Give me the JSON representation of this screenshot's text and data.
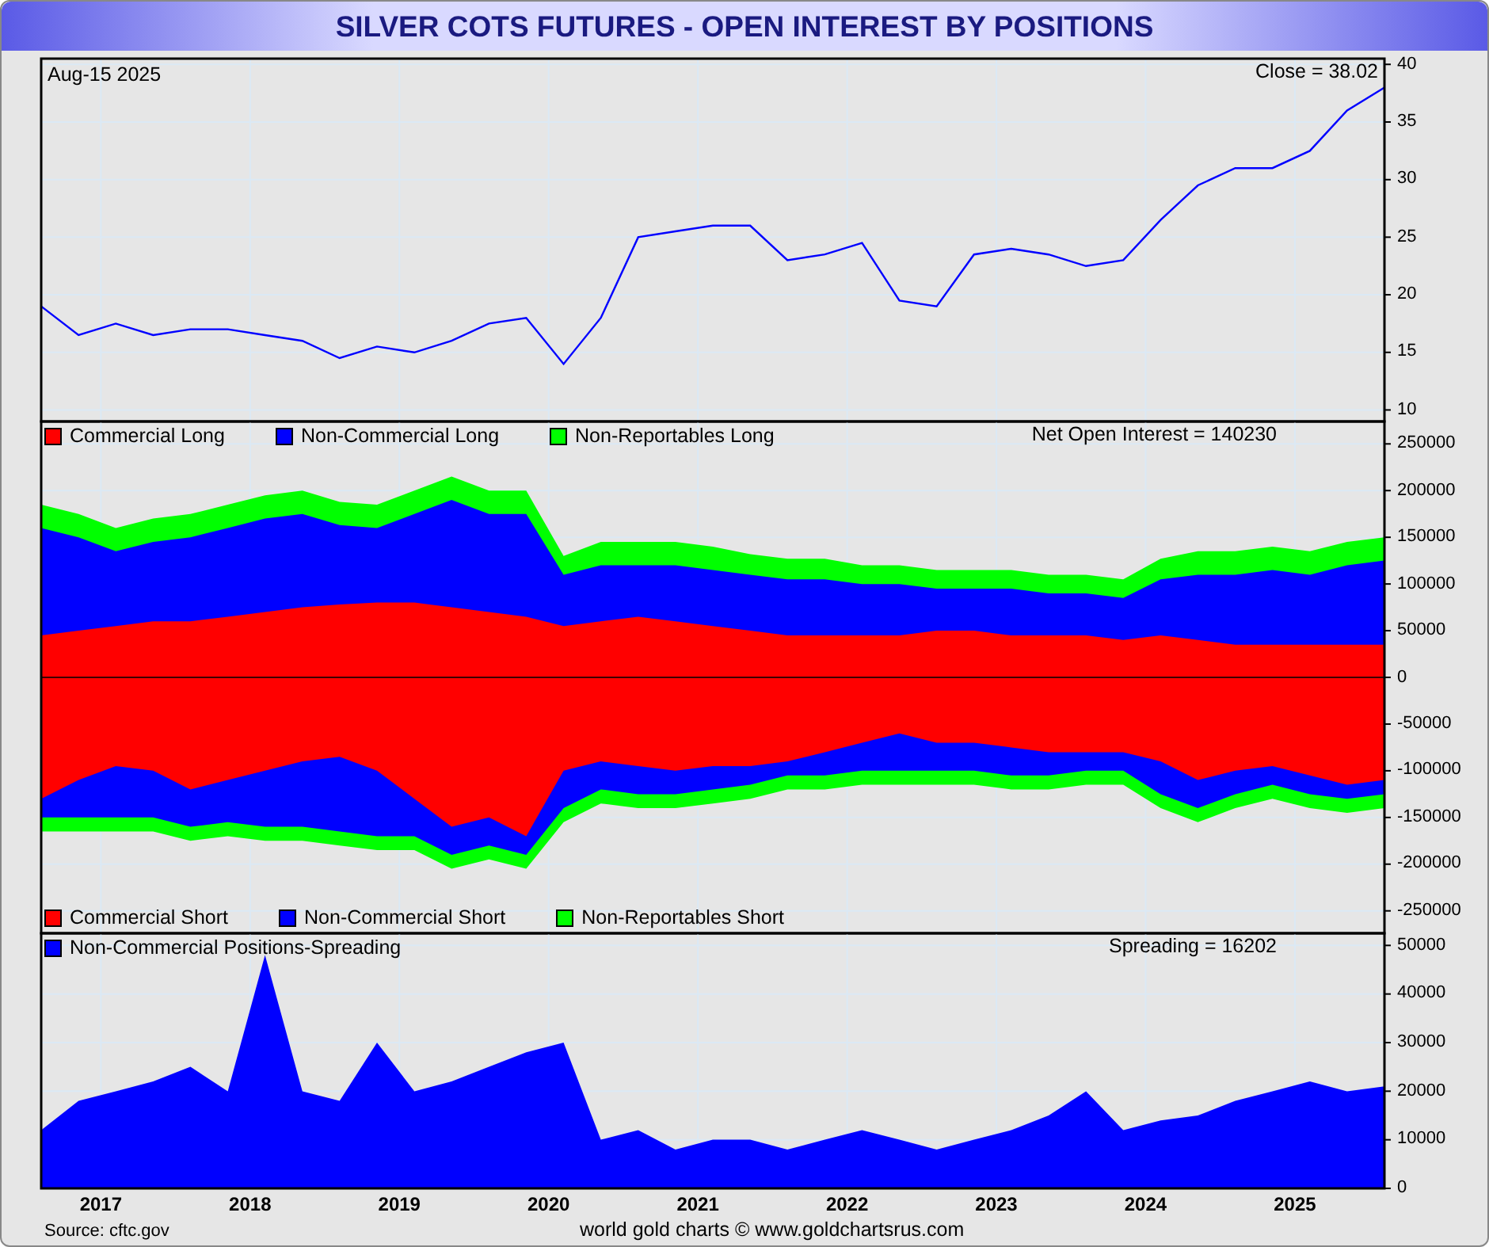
{
  "title": "SILVER COTS FUTURES - OPEN INTEREST BY POSITIONS",
  "panels": [
    {
      "kind": "line",
      "date": "Aug-15  2025",
      "readout": "Close = 38.02",
      "chart_data": {
        "type": "line",
        "x": [
          2016.6,
          2016.85,
          2017.1,
          2017.35,
          2017.6,
          2017.85,
          2018.1,
          2018.35,
          2018.6,
          2018.85,
          2019.1,
          2019.35,
          2019.6,
          2019.85,
          2020.1,
          2020.35,
          2020.6,
          2020.85,
          2021.1,
          2021.35,
          2021.6,
          2021.85,
          2022.1,
          2022.35,
          2022.6,
          2022.85,
          2023.1,
          2023.35,
          2023.6,
          2023.85,
          2024.1,
          2024.35,
          2024.6,
          2024.85,
          2025.1,
          2025.35,
          2025.6
        ],
        "xlim": [
          2016.6,
          2025.6
        ],
        "grid": true,
        "ylim": [
          9,
          40.5
        ],
        "yticks": [
          10,
          15,
          20,
          25,
          30,
          35,
          40
        ],
        "series": [
          {
            "color": "#0000ff",
            "values": [
              19,
              16.5,
              17.5,
              16.5,
              17,
              17,
              16.5,
              16,
              14.5,
              15.5,
              15,
              16,
              17.5,
              18,
              14,
              18,
              25,
              25.5,
              26,
              26,
              23,
              23.5,
              24.5,
              19.5,
              19,
              23.5,
              24,
              23.5,
              22.5,
              23,
              26.5,
              29.5,
              31,
              31,
              32.5,
              36,
              38
            ]
          }
        ]
      }
    },
    {
      "kind": "stacked",
      "readout": "Net Open Interest = 140230",
      "chart_data": {
        "type": "area",
        "x": [
          2016.6,
          2016.85,
          2017.1,
          2017.35,
          2017.6,
          2017.85,
          2018.1,
          2018.35,
          2018.6,
          2018.85,
          2019.1,
          2019.35,
          2019.6,
          2019.85,
          2020.1,
          2020.35,
          2020.6,
          2020.85,
          2021.1,
          2021.35,
          2021.6,
          2021.85,
          2022.1,
          2022.35,
          2022.6,
          2022.85,
          2023.1,
          2023.35,
          2023.6,
          2023.85,
          2024.1,
          2024.35,
          2024.6,
          2024.85,
          2025.1,
          2025.35,
          2025.6
        ],
        "xlim": [
          2016.6,
          2025.6
        ],
        "ylim": [
          -274000,
          274000
        ],
        "grid": true,
        "legend": "left",
        "yticks": [
          -250000,
          -200000,
          -150000,
          -100000,
          -50000,
          0,
          50000,
          100000,
          150000,
          200000,
          250000
        ],
        "series": [
          {
            "name": "Commercial Long",
            "color": "#ff0000",
            "values": [
              45000,
              50000,
              55000,
              60000,
              60000,
              65000,
              70000,
              75000,
              78000,
              80000,
              80000,
              75000,
              70000,
              65000,
              55000,
              60000,
              65000,
              60000,
              55000,
              50000,
              45000,
              45000,
              45000,
              45000,
              50000,
              50000,
              45000,
              45000,
              45000,
              40000,
              45000,
              40000,
              35000,
              35000,
              35000,
              35000,
              35000
            ]
          },
          {
            "name": "Non-Commercial Long",
            "color": "#0000ff",
            "values": [
              160000,
              150000,
              135000,
              145000,
              150000,
              160000,
              170000,
              175000,
              163000,
              160000,
              175000,
              190000,
              175000,
              175000,
              110000,
              120000,
              120000,
              120000,
              115000,
              110000,
              105000,
              105000,
              100000,
              100000,
              95000,
              95000,
              95000,
              90000,
              90000,
              85000,
              105000,
              110000,
              110000,
              115000,
              110000,
              120000,
              125000
            ]
          },
          {
            "name": "Non-Reportables Long",
            "color": "#00ff00",
            "values": [
              185000,
              175000,
              160000,
              170000,
              175000,
              185000,
              195000,
              200000,
              188000,
              185000,
              200000,
              215000,
              200000,
              200000,
              130000,
              145000,
              145000,
              145000,
              140000,
              132000,
              127000,
              127000,
              120000,
              120000,
              115000,
              115000,
              115000,
              110000,
              110000,
              105000,
              127000,
              135000,
              135000,
              140000,
              135000,
              145000,
              150000
            ]
          },
          {
            "name": "Commercial Short",
            "color": "#ff0000",
            "values": [
              -130000,
              -110000,
              -95000,
              -100000,
              -120000,
              -110000,
              -100000,
              -90000,
              -85000,
              -100000,
              -130000,
              -160000,
              -150000,
              -170000,
              -100000,
              -90000,
              -95000,
              -100000,
              -95000,
              -95000,
              -90000,
              -80000,
              -70000,
              -60000,
              -70000,
              -70000,
              -75000,
              -80000,
              -80000,
              -80000,
              -90000,
              -110000,
              -100000,
              -95000,
              -105000,
              -115000,
              -110000
            ]
          },
          {
            "name": "Non-Commercial Short",
            "color": "#0000ff",
            "values": [
              -150000,
              -150000,
              -150000,
              -150000,
              -160000,
              -155000,
              -160000,
              -160000,
              -165000,
              -170000,
              -170000,
              -190000,
              -180000,
              -190000,
              -140000,
              -120000,
              -125000,
              -125000,
              -120000,
              -115000,
              -105000,
              -105000,
              -100000,
              -100000,
              -100000,
              -100000,
              -105000,
              -105000,
              -100000,
              -100000,
              -125000,
              -140000,
              -125000,
              -115000,
              -125000,
              -130000,
              -125000
            ]
          },
          {
            "name": "Non-Reportables Short",
            "color": "#00ff00",
            "values": [
              -165000,
              -165000,
              -165000,
              -165000,
              -175000,
              -170000,
              -175000,
              -175000,
              -180000,
              -185000,
              -185000,
              -205000,
              -195000,
              -205000,
              -155000,
              -135000,
              -140000,
              -140000,
              -135000,
              -130000,
              -120000,
              -120000,
              -115000,
              -115000,
              -115000,
              -115000,
              -120000,
              -120000,
              -115000,
              -115000,
              -140000,
              -155000,
              -140000,
              -130000,
              -140000,
              -145000,
              -140000
            ]
          }
        ]
      }
    },
    {
      "kind": "area",
      "readout": "Spreading = 16202",
      "chart_data": {
        "type": "area",
        "x": [
          2016.6,
          2016.85,
          2017.1,
          2017.35,
          2017.6,
          2017.85,
          2018.1,
          2018.35,
          2018.6,
          2018.85,
          2019.1,
          2019.35,
          2019.6,
          2019.85,
          2020.1,
          2020.35,
          2020.6,
          2020.85,
          2021.1,
          2021.35,
          2021.6,
          2021.85,
          2022.1,
          2022.35,
          2022.6,
          2022.85,
          2023.1,
          2023.35,
          2023.6,
          2023.85,
          2024.1,
          2024.35,
          2024.6,
          2024.85,
          2025.1,
          2025.35,
          2025.6
        ],
        "xlim": [
          2016.6,
          2025.6
        ],
        "xticks": [
          {
            "value": 2017,
            "label": "2017"
          },
          {
            "value": 2018,
            "label": "2018"
          },
          {
            "value": 2019,
            "label": "2019"
          },
          {
            "value": 2020,
            "label": "2020"
          },
          {
            "value": 2021,
            "label": "2021"
          },
          {
            "value": 2022,
            "label": "2022"
          },
          {
            "value": 2023,
            "label": "2023"
          },
          {
            "value": 2024,
            "label": "2024"
          },
          {
            "value": 2025,
            "label": "2025"
          }
        ],
        "ylim": [
          0,
          52500
        ],
        "grid": true,
        "legend": "top-left",
        "yticks": [
          0,
          10000,
          20000,
          30000,
          40000,
          50000
        ],
        "series": [
          {
            "name": "Non-Commercial Positions-Spreading",
            "color": "#0000ff",
            "values": [
              12000,
              18000,
              20000,
              22000,
              25000,
              20000,
              48000,
              20000,
              18000,
              30000,
              20000,
              22000,
              25000,
              28000,
              30000,
              10000,
              12000,
              8000,
              10000,
              10000,
              8000,
              10000,
              12000,
              10000,
              8000,
              10000,
              12000,
              15000,
              20000,
              12000,
              14000,
              15000,
              18000,
              20000,
              22000,
              20000,
              21000
            ]
          }
        ]
      }
    }
  ],
  "source": "Source: cftc.gov",
  "credit": "world gold charts © www.goldchartsrus.com"
}
